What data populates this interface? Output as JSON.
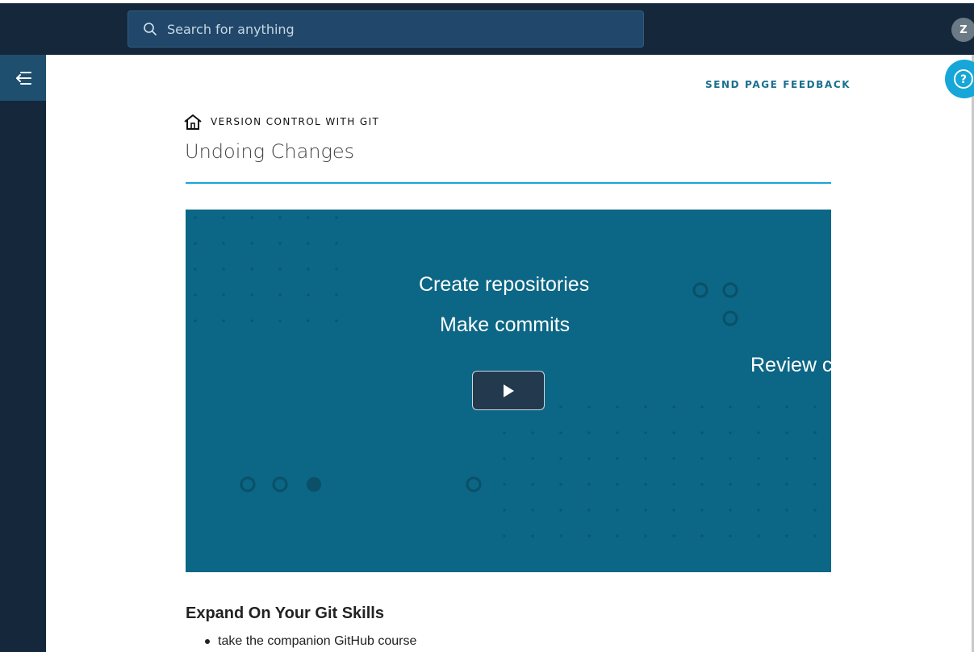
{
  "topbar": {
    "search_placeholder": "Search for anything",
    "avatar_initial": "Z"
  },
  "page": {
    "feedback_label": "SEND PAGE FEEDBACK",
    "breadcrumb": "VERSION CONTROL WITH GIT",
    "title": "Undoing Changes"
  },
  "video": {
    "lines": [
      "Create repositories",
      "Make commits",
      "Review c"
    ]
  },
  "section": {
    "heading": "Expand On Your Git Skills",
    "items": [
      "take the companion GitHub course"
    ]
  },
  "colors": {
    "nav_bg": "#15283b",
    "search_bg": "#21486a",
    "accent": "#16a6d8",
    "video_bg": "#0c6685",
    "feedback": "#1a6f8f"
  },
  "icons": [
    "search-icon",
    "collapse-sidebar-icon",
    "help-icon",
    "home-icon",
    "play-icon"
  ]
}
